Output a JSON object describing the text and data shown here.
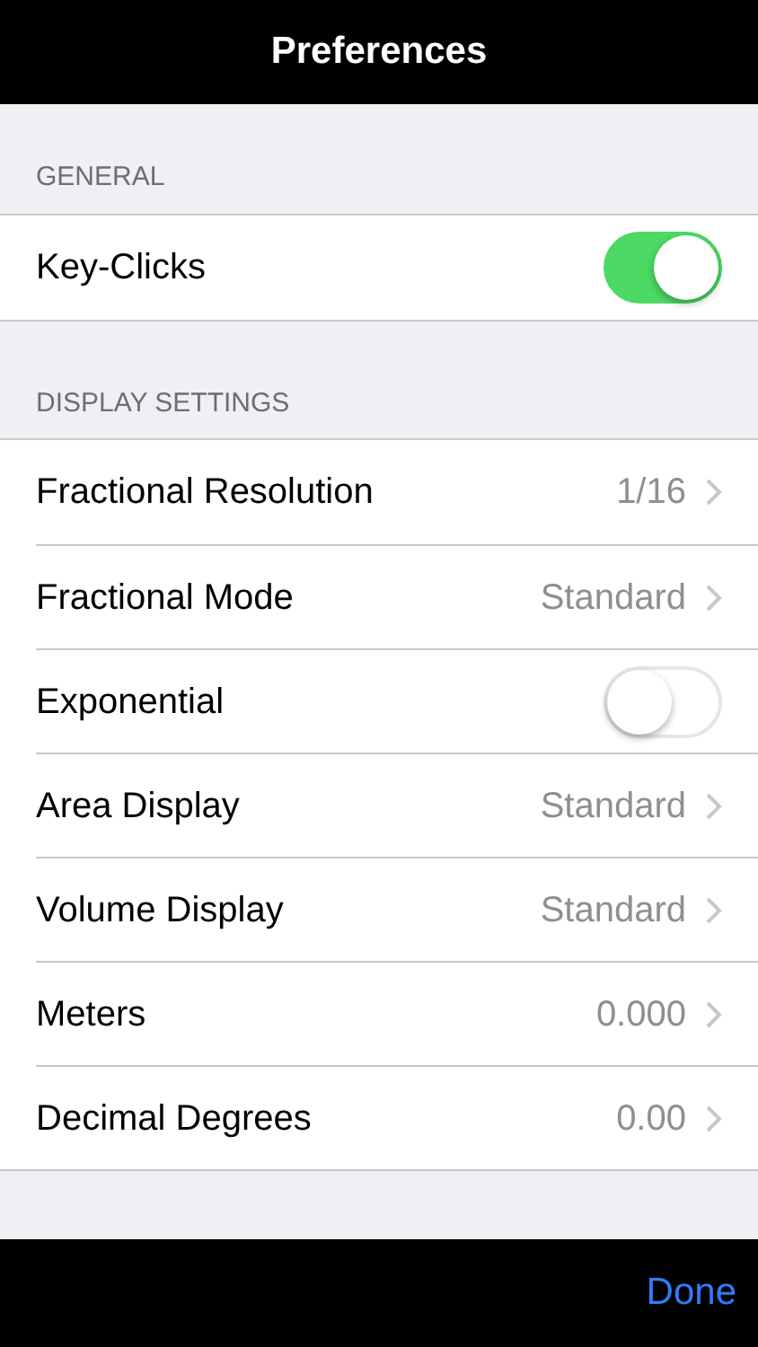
{
  "header": {
    "title": "Preferences"
  },
  "sections": [
    {
      "title": "GENERAL",
      "rows": [
        {
          "kind": "switch",
          "label": "Key-Clicks",
          "on": true
        }
      ]
    },
    {
      "title": "DISPLAY SETTINGS",
      "rows": [
        {
          "kind": "disclosure",
          "label": "Fractional Resolution",
          "value": "1/16"
        },
        {
          "kind": "disclosure",
          "label": "Fractional Mode",
          "value": "Standard"
        },
        {
          "kind": "switch",
          "label": "Exponential",
          "on": false
        },
        {
          "kind": "disclosure",
          "label": "Area Display",
          "value": "Standard"
        },
        {
          "kind": "disclosure",
          "label": "Volume Display",
          "value": "Standard"
        },
        {
          "kind": "disclosure",
          "label": "Meters",
          "value": "0.000"
        },
        {
          "kind": "disclosure",
          "label": "Decimal Degrees",
          "value": "0.00"
        }
      ]
    }
  ],
  "toolbar": {
    "done": "Done"
  }
}
